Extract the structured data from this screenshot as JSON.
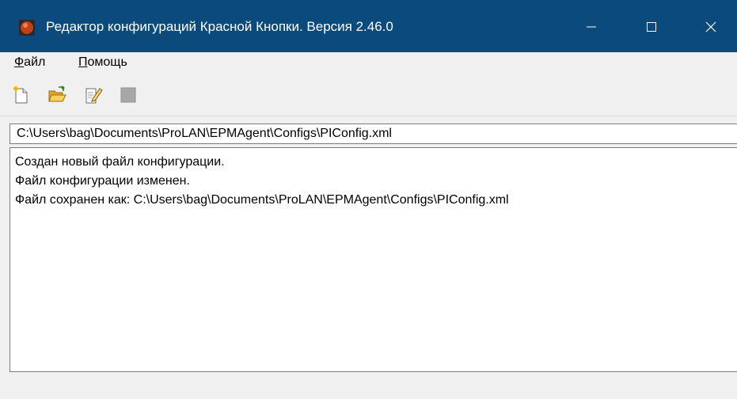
{
  "window": {
    "title": "Редактор конфигураций Красной Кнопки. Версия 2.46.0",
    "titlebar_color": "#0b4a7c",
    "icons": {
      "app": "red-button-app-icon",
      "minimize": "minimize-icon",
      "maximize": "maximize-icon",
      "close": "close-icon"
    }
  },
  "menu": {
    "file_underlined": "Ф",
    "file_rest": "айл",
    "help_underlined": "П",
    "help_rest": "омощь"
  },
  "toolbar": {
    "icons": [
      "new-file-icon",
      "open-folder-icon",
      "edit-document-icon",
      "stop-icon"
    ]
  },
  "path": {
    "value": "C:\\Users\\bag\\Documents\\ProLAN\\EPMAgent\\Configs\\PIConfig.xml"
  },
  "log": {
    "lines": [
      "Создан новый файл конфигурации.",
      "Файл конфигурации изменен.",
      "Файл сохранен как: C:\\Users\\bag\\Documents\\ProLAN\\EPMAgent\\Configs\\PIConfig.xml"
    ]
  }
}
